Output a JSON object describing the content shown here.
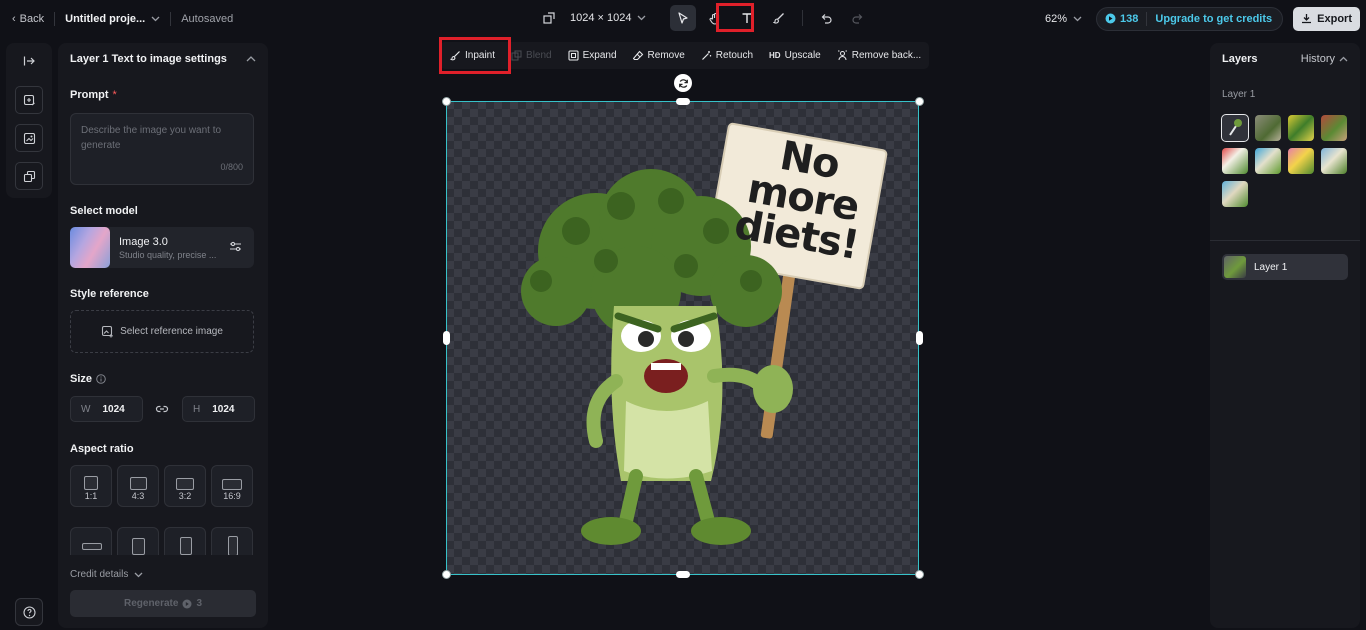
{
  "topbar": {
    "back_label": "Back",
    "project_name": "Untitled proje...",
    "autosaved": "Autosaved",
    "dimensions": "1024 × 1024",
    "zoom": "62%",
    "credits": "138",
    "upgrade": "Upgrade to get credits",
    "export": "Export"
  },
  "settings": {
    "header": "Layer 1 Text to image settings",
    "prompt_label": "Prompt",
    "required_mark": "*",
    "prompt_placeholder": "Describe the image you want to generate",
    "prompt_count": "0/800",
    "model_label": "Select model",
    "model_name": "Image 3.0",
    "model_desc": "Studio quality, precise ...",
    "style_label": "Style reference",
    "style_button": "Select reference image",
    "size_label": "Size",
    "width_key": "W",
    "width_value": "1024",
    "height_key": "H",
    "height_value": "1024",
    "aspect_label": "Aspect ratio",
    "aspect_ratios": [
      "1:1",
      "4:3",
      "3:2",
      "16:9"
    ],
    "credit_details": "Credit details",
    "regenerate": "Regenerate",
    "regenerate_cost": "3"
  },
  "edit_toolbar": {
    "inpaint": "Inpaint",
    "blend": "Blend",
    "expand": "Expand",
    "remove": "Remove",
    "retouch": "Retouch",
    "upscale_badge": "HD",
    "upscale": "Upscale",
    "remove_background": "Remove back..."
  },
  "canvas": {
    "sign_line1": "No",
    "sign_line2": "more",
    "sign_line3": "diets!"
  },
  "layers_panel": {
    "title": "Layers",
    "history": "History",
    "group_label": "Layer 1",
    "layer_name": "Layer 1"
  },
  "colors": {
    "accent_cyan": "#4cc9ea",
    "selection": "#37c2c9",
    "highlight_red": "#e0202a",
    "background": "#101117"
  }
}
